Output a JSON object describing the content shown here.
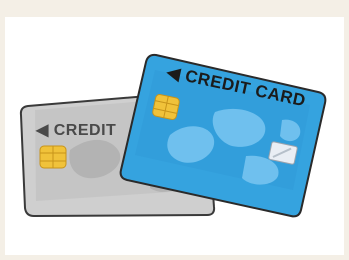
{
  "illustration": {
    "silver_card": {
      "label": "◀ CREDIT",
      "color": "#c8c8c8"
    },
    "blue_card": {
      "label": "◀ CREDIT CARD",
      "color": "#3aa6e0"
    },
    "colors": {
      "page_background": "#f4efe6",
      "frame": "#ffffff",
      "outline": "#3a3a3a",
      "chip": "#f0c23a"
    }
  }
}
